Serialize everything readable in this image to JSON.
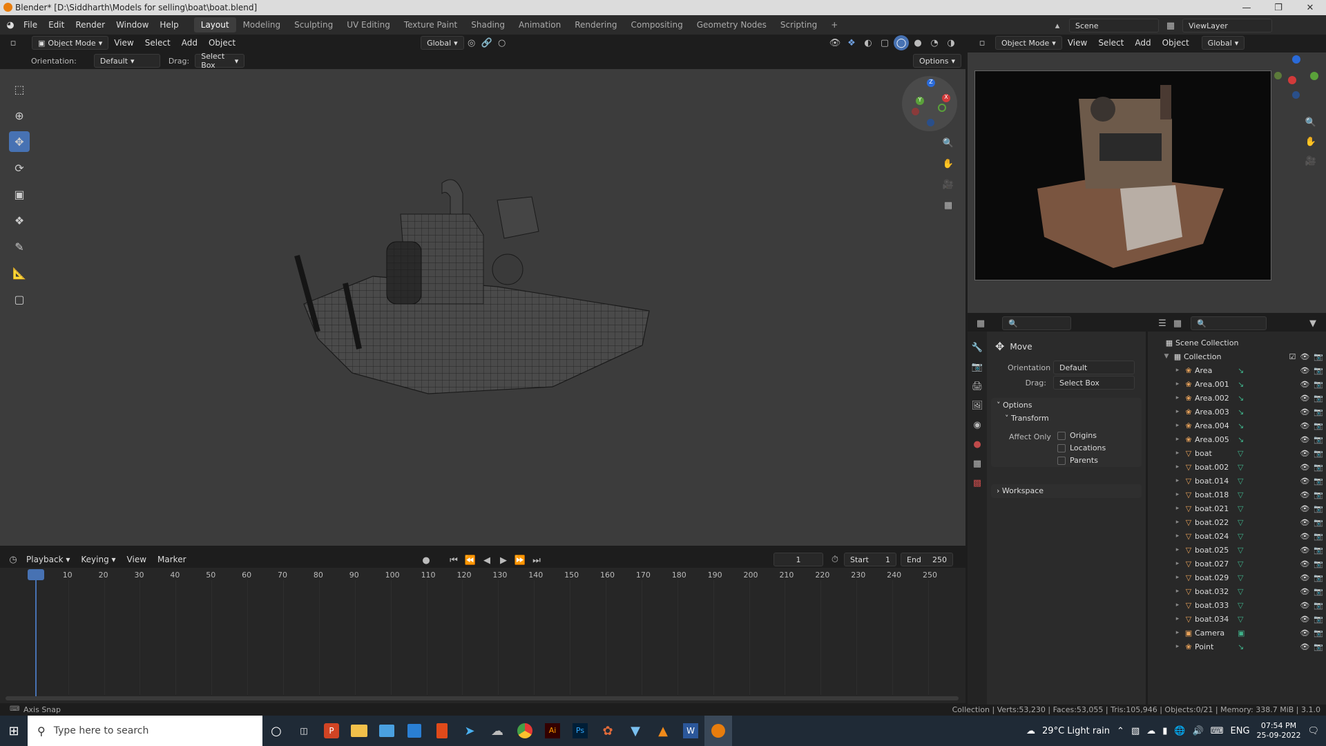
{
  "window": {
    "title": "Blender* [D:\\Siddharth\\Models for selling\\boat\\boat.blend]"
  },
  "menu": {
    "items": [
      "File",
      "Edit",
      "Render",
      "Window",
      "Help"
    ]
  },
  "workspaces": [
    "Layout",
    "Modeling",
    "Sculpting",
    "UV Editing",
    "Texture Paint",
    "Shading",
    "Animation",
    "Rendering",
    "Compositing",
    "Geometry Nodes",
    "Scripting"
  ],
  "scene": {
    "name": "Scene",
    "view_layer": "ViewLayer"
  },
  "viewport": {
    "mode": "Object Mode",
    "menus": [
      "View",
      "Select",
      "Add",
      "Object"
    ],
    "transform_orientation": "Global",
    "orientation_label": "Orientation:",
    "orientation_value": "Default",
    "drag_label": "Drag:",
    "drag_value": "Select Box",
    "options_label": "Options"
  },
  "render_preview": {
    "mode": "Object Mode",
    "menus": [
      "View",
      "Select",
      "Add",
      "Object"
    ],
    "orientation": "Global"
  },
  "timeline": {
    "menus": [
      "Playback",
      "Keying",
      "View",
      "Marker"
    ],
    "current_frame": "1",
    "start_label": "Start",
    "start": "1",
    "end_label": "End",
    "end": "250",
    "ticks": [
      "1",
      "10",
      "20",
      "30",
      "40",
      "50",
      "60",
      "70",
      "80",
      "90",
      "100",
      "110",
      "120",
      "130",
      "140",
      "150",
      "160",
      "170",
      "180",
      "190",
      "200",
      "210",
      "220",
      "230",
      "240",
      "250"
    ]
  },
  "properties": {
    "tool_name": "Move",
    "orientation_label": "Orientation",
    "orientation_value": "Default",
    "drag_label": "Drag:",
    "drag_value": "Select Box",
    "options_label": "Options",
    "transform_label": "Transform",
    "affect_only_label": "Affect Only",
    "affect_options": [
      "Origins",
      "Locations",
      "Parents"
    ],
    "workspace_label": "Workspace"
  },
  "outliner": {
    "scene_collection": "Scene Collection",
    "collection": "Collection",
    "items": [
      {
        "name": "Area",
        "type": "light"
      },
      {
        "name": "Area.001",
        "type": "light"
      },
      {
        "name": "Area.002",
        "type": "light"
      },
      {
        "name": "Area.003",
        "type": "light"
      },
      {
        "name": "Area.004",
        "type": "light"
      },
      {
        "name": "Area.005",
        "type": "light"
      },
      {
        "name": "boat",
        "type": "mesh"
      },
      {
        "name": "boat.002",
        "type": "mesh"
      },
      {
        "name": "boat.014",
        "type": "mesh"
      },
      {
        "name": "boat.018",
        "type": "mesh"
      },
      {
        "name": "boat.021",
        "type": "mesh"
      },
      {
        "name": "boat.022",
        "type": "mesh"
      },
      {
        "name": "boat.024",
        "type": "mesh"
      },
      {
        "name": "boat.025",
        "type": "mesh"
      },
      {
        "name": "boat.027",
        "type": "mesh"
      },
      {
        "name": "boat.029",
        "type": "mesh"
      },
      {
        "name": "boat.032",
        "type": "mesh"
      },
      {
        "name": "boat.033",
        "type": "mesh"
      },
      {
        "name": "boat.034",
        "type": "mesh"
      },
      {
        "name": "Camera",
        "type": "camera"
      },
      {
        "name": "Point",
        "type": "light"
      }
    ]
  },
  "statusbar": {
    "left": "Axis Snap",
    "stats": "Collection | Verts:53,230 | Faces:53,055 | Tris:105,946 | Objects:0/21 | Memory: 338.7 MiB | 3.1.0"
  },
  "taskbar": {
    "search_placeholder": "Type here to search",
    "weather": "29°C  Light rain",
    "lang": "ENG",
    "time": "07:54 PM",
    "date": "25-09-2022"
  },
  "colors": {
    "accent": "#4772b3",
    "mesh": "#e8a25a",
    "light": "#e8a25a",
    "green": "#3fb28a"
  }
}
